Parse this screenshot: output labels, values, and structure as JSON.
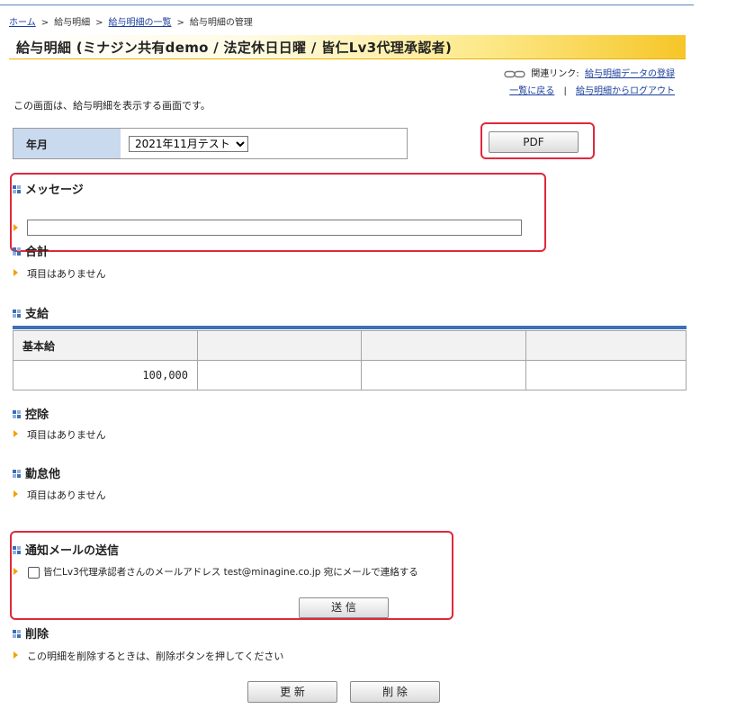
{
  "breadcrumb": {
    "home": "ホーム",
    "payslip": "給与明細",
    "list": "給与明細の一覧",
    "current": "給与明細の管理",
    "sep": ">"
  },
  "title": "給与明細 (ミナジン共有demo / 法定休日日曜 / 皆仁Lv3代理承認者)",
  "related": {
    "label": "関連リンク:",
    "register": "給与明細データの登録",
    "back": "一覧に戻る",
    "divider": "|",
    "logout": "給与明細からログアウト"
  },
  "description": "この画面は、給与明細を表示する画面です。",
  "year_month": {
    "label": "年月",
    "selected": "2021年11月テスト"
  },
  "pdf_button": "PDF",
  "sections": {
    "message": {
      "title": "メッセージ",
      "value": ""
    },
    "total": {
      "title": "合計",
      "item": "項目はありません"
    },
    "payment": {
      "title": "支給",
      "headers": [
        "基本給",
        "",
        "",
        ""
      ],
      "values": [
        "100,000",
        "",
        "",
        ""
      ]
    },
    "deduction": {
      "title": "控除",
      "item": "項目はありません"
    },
    "attendance": {
      "title": "勤怠他",
      "item": "項目はありません"
    },
    "notify": {
      "title": "通知メールの送信",
      "checkbox_label": "皆仁Lv3代理承認者さんのメールアドレス test@minagine.co.jp 宛にメールで連絡する",
      "send_button": "送 信"
    },
    "delete": {
      "title": "削除",
      "item": "この明細を削除するときは、削除ボタンを押してください"
    }
  },
  "buttons": {
    "update": "更 新",
    "delete": "削 除"
  },
  "colors": {
    "accent_blue": "#3c6fb5",
    "highlight_red": "#e0283c",
    "bullet_orange": "#f2a10a",
    "title_gold": "#f6c628"
  }
}
